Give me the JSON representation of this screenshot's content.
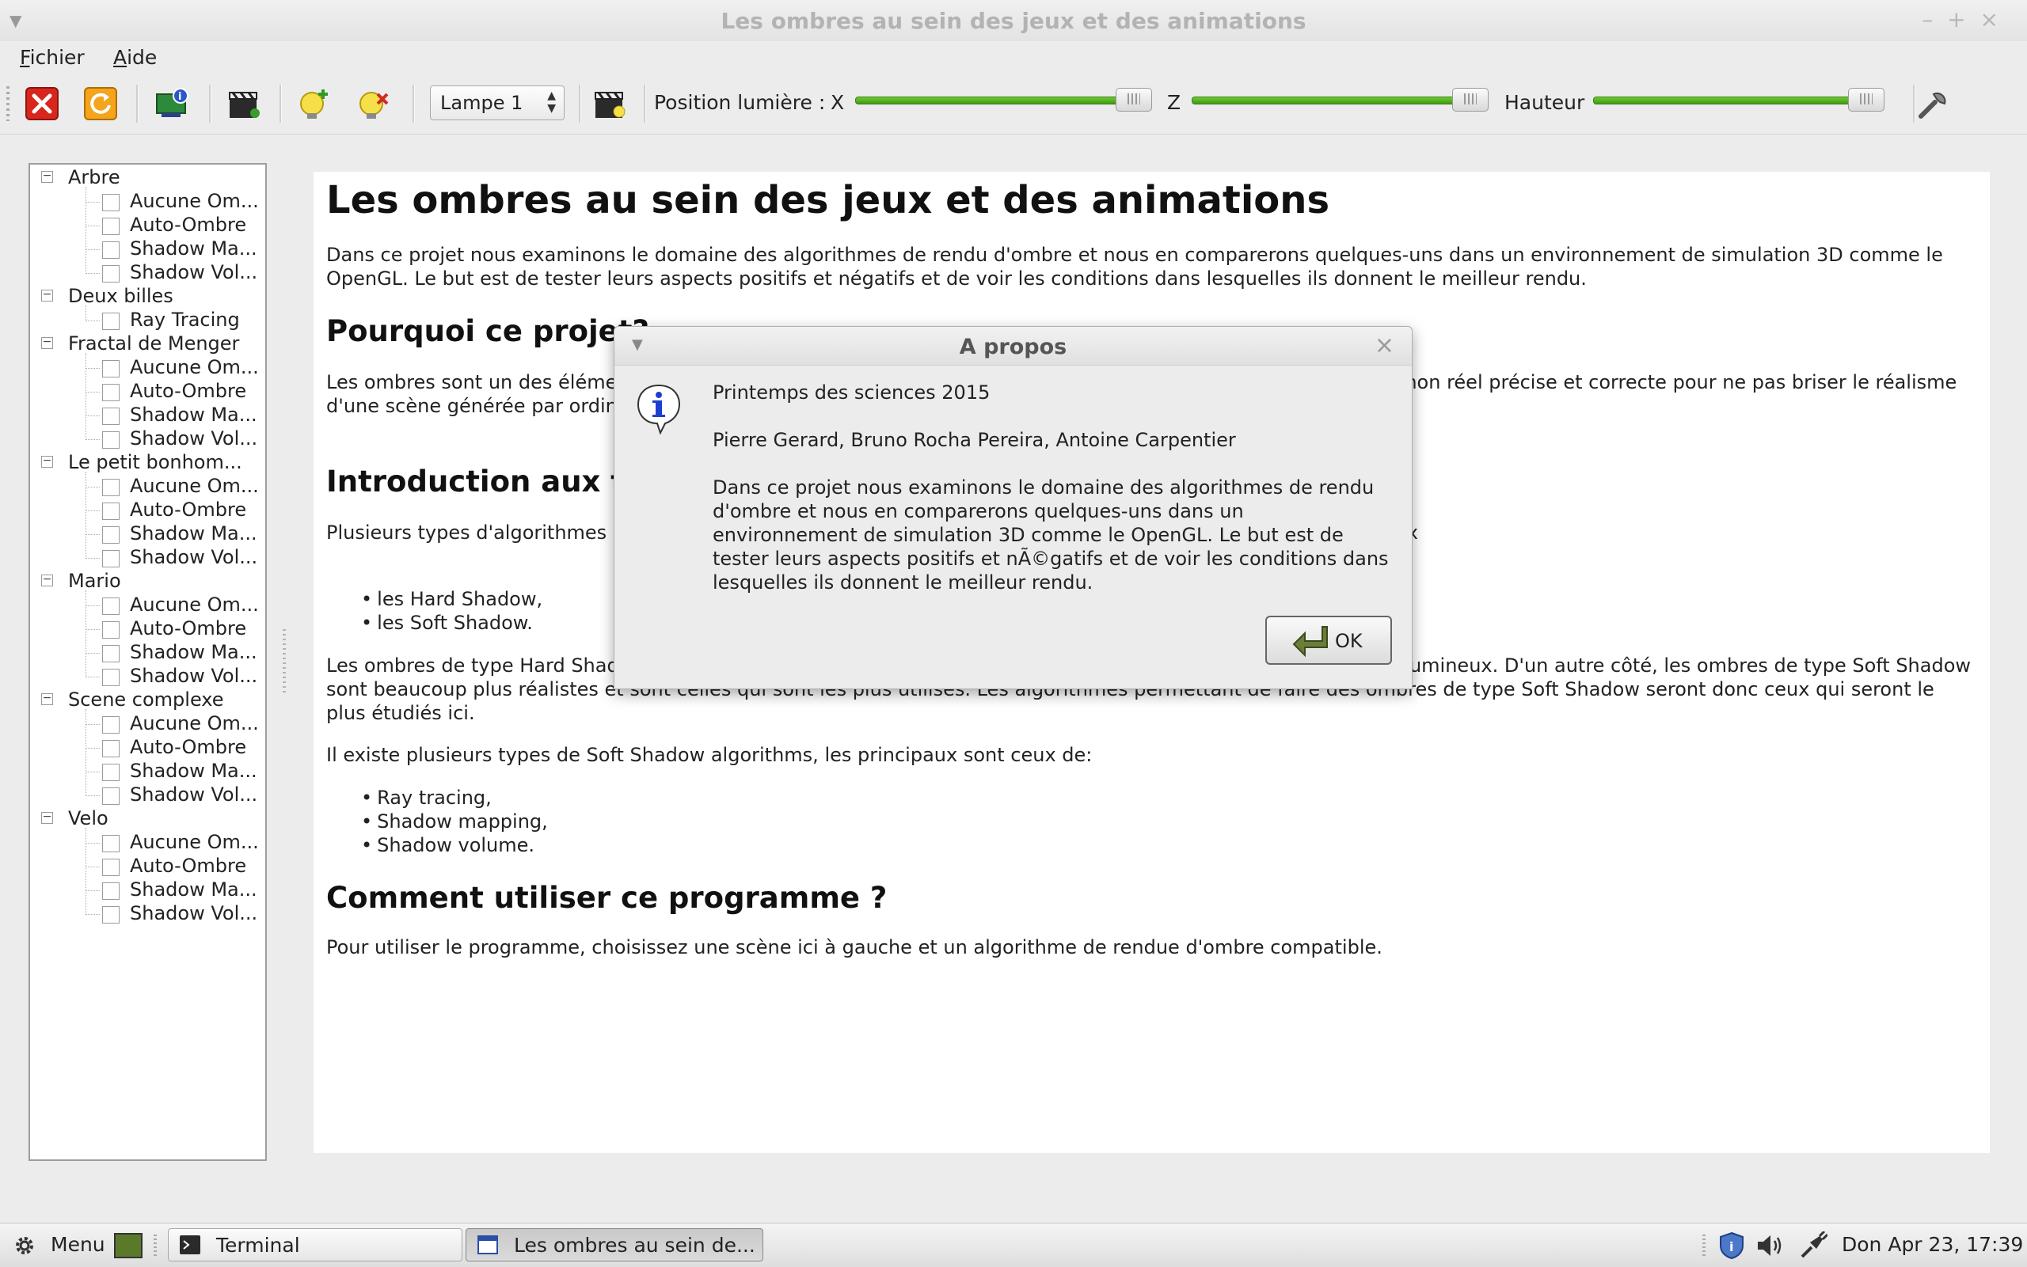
{
  "window": {
    "title": "Les ombres au sein des jeux et des animations",
    "controls": [
      "–",
      "+",
      "×"
    ]
  },
  "menubar": {
    "items": [
      "Fichier",
      "Aide"
    ]
  },
  "toolbar": {
    "icons": [
      "close-red-icon",
      "refresh-icon",
      "monitor-info-icon",
      "clapperboard-icon",
      "add-light-icon",
      "remove-light-icon",
      "clapperboard-light-icon",
      "settings-tool-icon"
    ],
    "lamp_select": {
      "value": "Lampe 1"
    },
    "position_label": "Position lumière :",
    "x_label": "X",
    "z_label": "Z",
    "height_label": "Hauteur",
    "sliders": {
      "x": 1.0,
      "z": 1.0,
      "height": 1.0
    }
  },
  "tree": {
    "groups": [
      {
        "label": "Arbre",
        "children": [
          "Aucune Om...",
          "Auto-Ombre",
          "Shadow Ma...",
          "Shadow Vol..."
        ]
      },
      {
        "label": "Deux billes",
        "children": [
          "Ray Tracing"
        ]
      },
      {
        "label": "Fractal de Menger",
        "children": [
          "Aucune Om...",
          "Auto-Ombre",
          "Shadow Ma...",
          "Shadow Vol..."
        ]
      },
      {
        "label": "Le petit bonhom...",
        "children": [
          "Aucune Om...",
          "Auto-Ombre",
          "Shadow Ma...",
          "Shadow Vol..."
        ]
      },
      {
        "label": "Mario",
        "children": [
          "Aucune Om...",
          "Auto-Ombre",
          "Shadow Ma...",
          "Shadow Vol..."
        ]
      },
      {
        "label": "Scene complexe",
        "children": [
          "Aucune Om...",
          "Auto-Ombre",
          "Shadow Ma...",
          "Shadow Vol..."
        ]
      },
      {
        "label": "Velo",
        "children": [
          "Aucune Om...",
          "Auto-Ombre",
          "Shadow Ma...",
          "Shadow Vol..."
        ]
      }
    ],
    "expander": "−"
  },
  "document": {
    "title": "Les ombres au sein des jeux et des animations",
    "intro": "Dans ce projet nous examinons le domaine des algorithmes de rendu d'ombre et nous en comparerons quelques-uns dans un environnement de simulation 3D comme le OpenGL. Le but est de tester leurs aspects positifs et négatifs et de voir les conditions dans lesquelles ils donnent le meilleur rendu.",
    "h2_why": "Pourquoi ce projet?",
    "p_why": "Les ombres sont un des éléments                                                                                                   nner des informations indispensables pour la perception humaine d'une scène non réel                                                                                                  précise et correcte pour ne pas briser le réalisme d'une scène générée par ordinateur.",
    "h2_intro": "Introduction aux techniques",
    "p_intro": "Plusieurs types d'algorithmes                                                                                                    ure scientifique. Ceux-ci représentent des ombres qui peuvent être divisées en deux",
    "list_types": [
      "les Hard Shadow,",
      "les Soft Shadow."
    ],
    "p_hard": "Les ombres de type Hard Shadow                                                                                                   sont uniformément noire et ne représentent que l'ombre générée par un point lumineux. D'un autre côté, les ombres de type Soft Shadow sont beaucoup plus réalistes et sont celles qui sont les plus utilisés. Les algorithmes permettant de faire des ombres de type Soft Shadow seront donc ceux qui seront le plus étudiés ici.",
    "p_soft": "Il existe plusieurs types de Soft Shadow algorithms, les principaux sont ceux de:",
    "list_algos": [
      "Ray tracing,",
      "Shadow mapping,",
      "Shadow volume."
    ],
    "h2_how": "Comment utiliser ce programme ?",
    "p_how": "Pour utiliser le programme, choisissez une scène ici à gauche et un algorithme de rendue d'ombre compatible."
  },
  "dialog": {
    "title": "A propos",
    "close": "×",
    "line1": "Printemps des sciences 2015",
    "line2": "Pierre Gerard, Bruno Rocha Pereira, Antoine Carpentier",
    "line3": "Dans ce projet nous examinons le domaine des algorithmes de rendu d'ombre et nous en comparerons quelques-uns dans un environnement de simulation 3D comme le OpenGL. Le but est de tester leurs aspects positifs et nÃ©gatifs et de voir les conditions dans lesquelles ils donnent le meilleur rendu.",
    "ok_label": "OK",
    "icon": "info-icon"
  },
  "taskbar": {
    "menu_label": "Menu",
    "tasks": [
      {
        "label": "Terminal",
        "icon": "terminal-icon",
        "active": false
      },
      {
        "label": "Les ombres au sein de...",
        "icon": "window-icon",
        "active": true
      }
    ],
    "clock": "Don Apr 23, 17:39",
    "tray_icons": [
      "shield-icon",
      "volume-icon",
      "network-plug-icon"
    ]
  }
}
